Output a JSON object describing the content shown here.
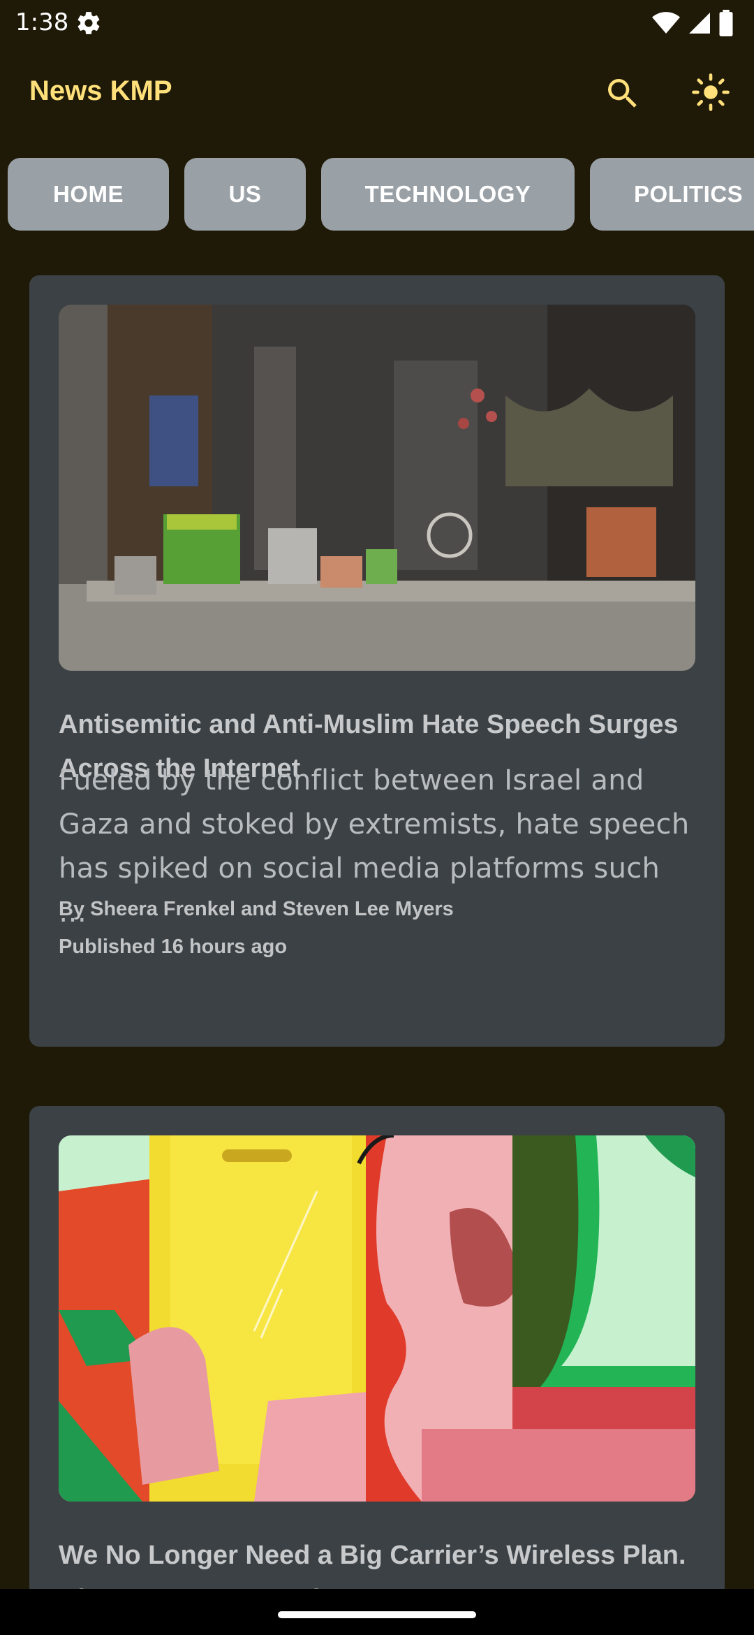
{
  "status_bar": {
    "time": "1:38"
  },
  "app_bar": {
    "title": "News KMP"
  },
  "tabs": [
    {
      "label": "HOME"
    },
    {
      "label": "US"
    },
    {
      "label": "TECHNOLOGY"
    },
    {
      "label": "POLITICS"
    }
  ],
  "articles": [
    {
      "title": "Antisemitic and Anti-Muslim Hate Speech Surges Across the Internet",
      "description": "Fueled by the conflict between Israel and Gaza and stoked by extremists, hate speech has spiked on social media platforms such …",
      "byline": "By Sheera Frenkel and Steven Lee Myers",
      "published": "Published 16 hours ago"
    },
    {
      "title": "We No Longer Need a Big Carrier’s Wireless Plan. Discount Ones Are the Way"
    }
  ],
  "colors": {
    "background": "#1f1a08",
    "accent": "#ffe07a",
    "tab_bg": "#9aa1a6",
    "card_bg": "#3b4145"
  }
}
